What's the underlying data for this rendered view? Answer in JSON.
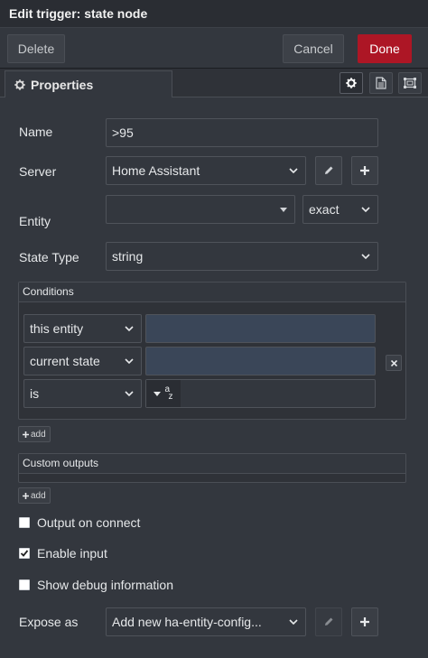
{
  "header": {
    "title": "Edit trigger: state node"
  },
  "toolbar": {
    "delete_label": "Delete",
    "cancel_label": "Cancel",
    "done_label": "Done"
  },
  "tabs": {
    "properties_label": "Properties"
  },
  "form": {
    "name_label": "Name",
    "name_value": ">95",
    "server_label": "Server",
    "server_value": "Home Assistant",
    "entity_label": "Entity",
    "entity_value": "",
    "entity_match_value": "exact",
    "state_type_label": "State Type",
    "state_type_value": "string"
  },
  "conditions": {
    "title": "Conditions",
    "rows": [
      {
        "select": "this entity",
        "input": ""
      },
      {
        "select": "current state",
        "input": ""
      },
      {
        "select": "is",
        "input": ""
      }
    ],
    "type_glyph_top": "a",
    "type_glyph_bottom": "z",
    "add_label": "add"
  },
  "custom_outputs": {
    "title": "Custom outputs",
    "add_label": "add"
  },
  "options": {
    "output_on_connect": {
      "label": "Output on connect",
      "checked": false
    },
    "enable_input": {
      "label": "Enable input",
      "checked": true
    },
    "show_debug": {
      "label": "Show debug information",
      "checked": false
    }
  },
  "expose": {
    "label": "Expose as",
    "value": "Add new ha-entity-config..."
  },
  "colors": {
    "done": "#ad1625",
    "background": "#33373e",
    "input_blue": "#3a4658"
  }
}
